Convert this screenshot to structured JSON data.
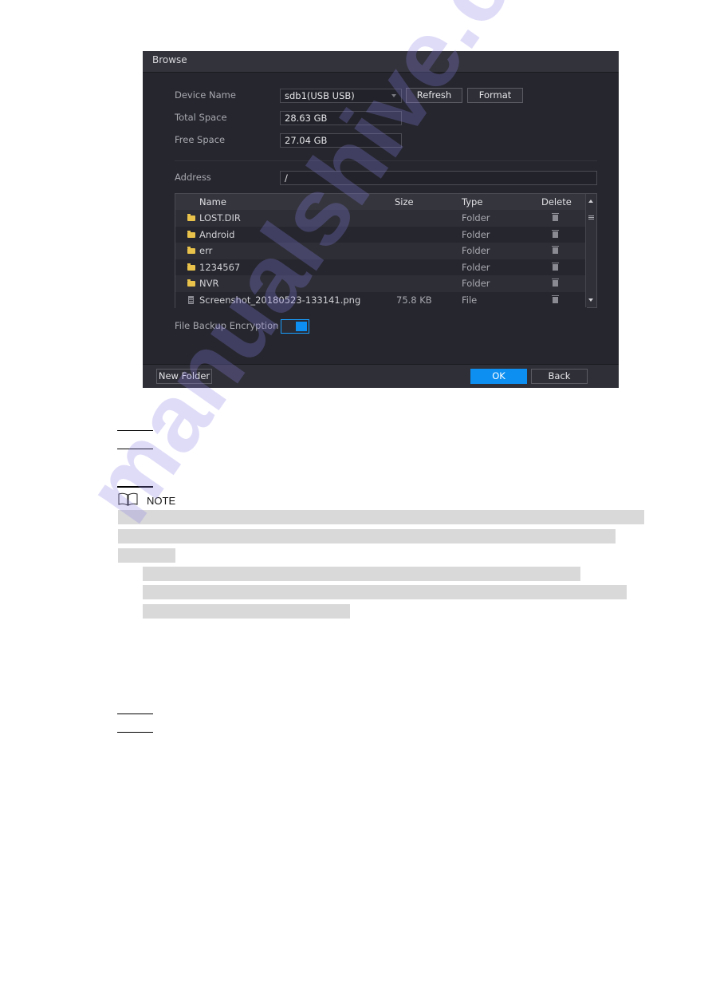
{
  "dialog": {
    "title": "Browse",
    "device_name_label": "Device Name",
    "device_name_value": "sdb1(USB USB)",
    "refresh_label": "Refresh",
    "format_label": "Format",
    "total_space_label": "Total Space",
    "total_space_value": "28.63 GB",
    "free_space_label": "Free Space",
    "free_space_value": "27.04 GB",
    "address_label": "Address",
    "address_value": "/",
    "table": {
      "columns": [
        "Name",
        "Size",
        "Type",
        "Delete"
      ],
      "rows": [
        {
          "name": "LOST.DIR",
          "size": "",
          "type": "Folder",
          "icon": "folder-icon"
        },
        {
          "name": "Android",
          "size": "",
          "type": "Folder",
          "icon": "folder-icon"
        },
        {
          "name": "err",
          "size": "",
          "type": "Folder",
          "icon": "folder-icon"
        },
        {
          "name": "1234567",
          "size": "",
          "type": "Folder",
          "icon": "folder-icon"
        },
        {
          "name": "NVR",
          "size": "",
          "type": "Folder",
          "icon": "folder-icon"
        },
        {
          "name": "Screenshot_20180523-133141.png",
          "size": "75.8 KB",
          "type": "File",
          "icon": "file-icon"
        }
      ]
    },
    "encryption_label": "File Backup Encryption",
    "encryption_enabled": true,
    "new_folder_label": "New Folder",
    "ok_label": "OK",
    "back_label": "Back"
  },
  "document": {
    "note_label": "NOTE",
    "watermark": "manualshive.com"
  },
  "colors": {
    "dialog_bg": "#25262e",
    "accent": "#0d8ff2",
    "folder": "#e8c24a"
  }
}
